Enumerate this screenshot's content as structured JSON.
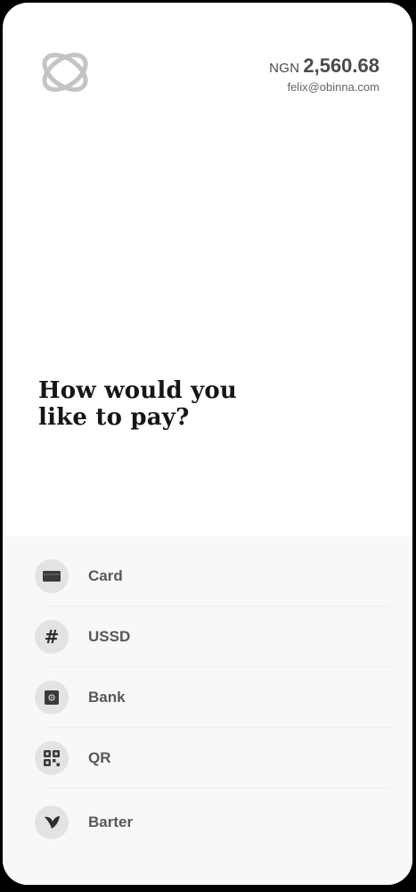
{
  "header": {
    "currency": "NGN",
    "amount": "2,560.68",
    "email": "felix@obinna.com"
  },
  "headline": {
    "line1": "How would you",
    "line2": "like to pay?"
  },
  "payment_methods": [
    {
      "label": "Card",
      "icon": "card-icon"
    },
    {
      "label": "USSD",
      "icon": "hash-icon"
    },
    {
      "label": "Bank",
      "icon": "bank-icon"
    },
    {
      "label": "QR",
      "icon": "qr-code-icon"
    },
    {
      "label": "Barter",
      "icon": "barter-icon"
    }
  ]
}
